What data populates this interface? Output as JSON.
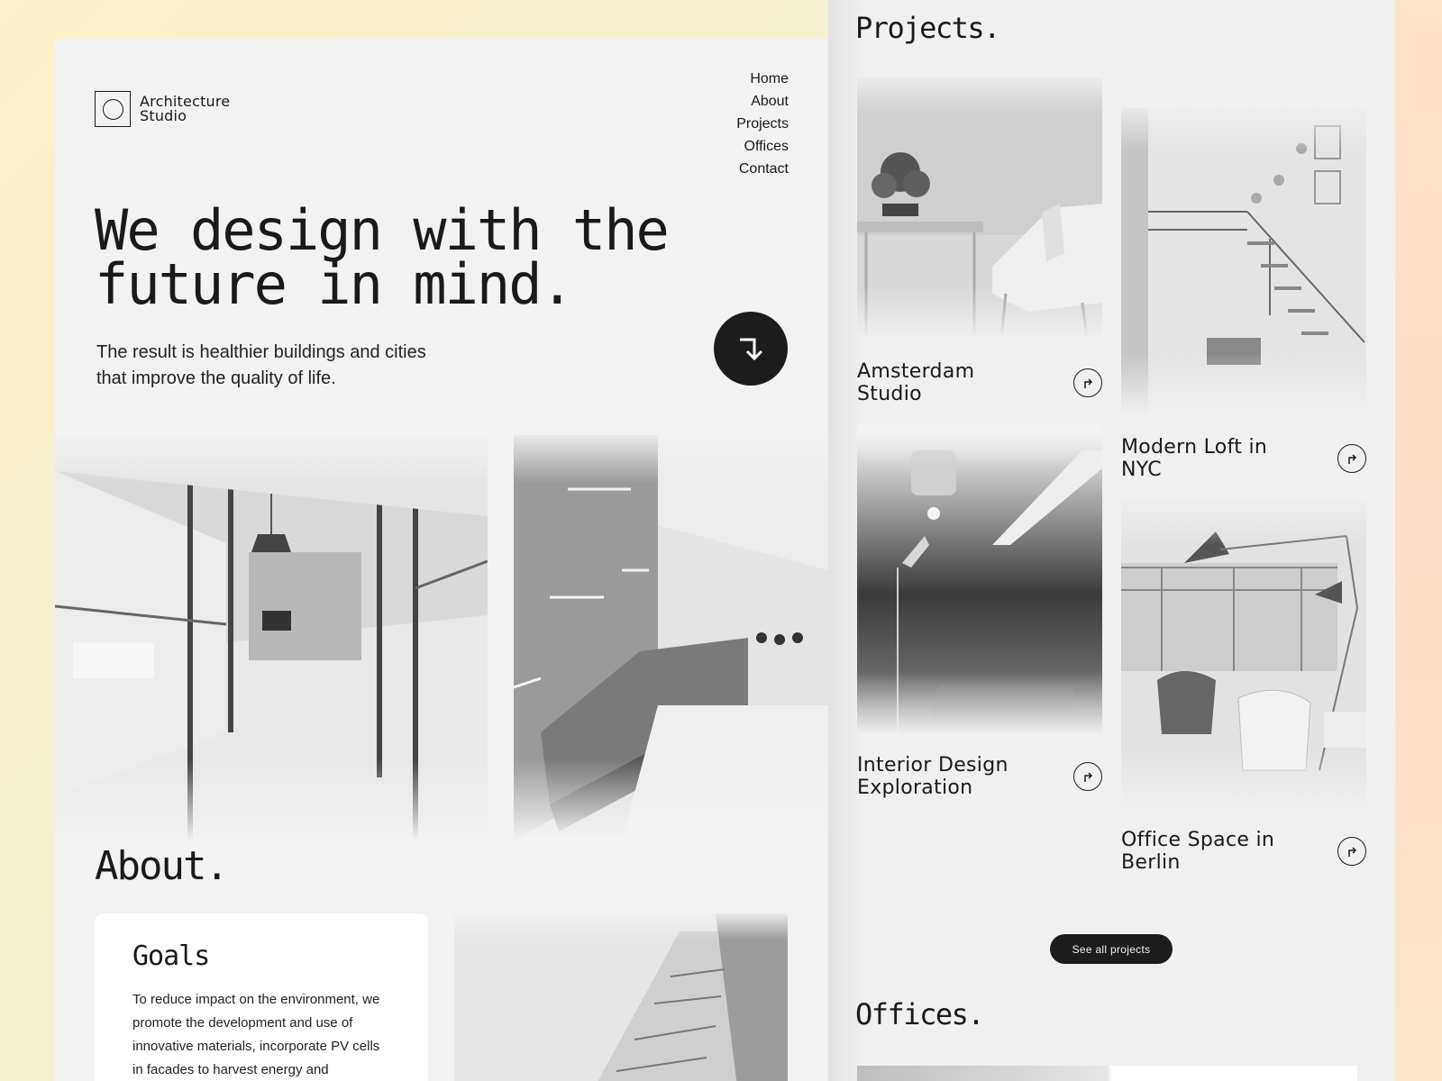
{
  "brand": {
    "line1": "Architecture",
    "line2": "Studio"
  },
  "nav": [
    "Home",
    "About",
    "Projects",
    "Offices",
    "Contact"
  ],
  "hero": {
    "title_line1": "We design with the",
    "title_line2": "future in mind.",
    "subtitle_line1": "The result is healthier buildings and cities",
    "subtitle_line2": "that improve the quality of life."
  },
  "about": {
    "title": "About.",
    "goals_title": "Goals",
    "goals_text": "To reduce impact on the environment, we promote the development and use of innovative materials, incorporate PV cells in facades to harvest energy and"
  },
  "projects": {
    "title": "Projects.",
    "items": [
      {
        "name_line1": "Amsterdam",
        "name_line2": "Studio"
      },
      {
        "name_line1": "Modern Loft in",
        "name_line2": "NYC"
      },
      {
        "name_line1": "Interior Design",
        "name_line2": "Exploration"
      },
      {
        "name_line1": "Office Space in",
        "name_line2": "Berlin"
      }
    ],
    "see_all": "See all projects"
  },
  "offices": {
    "title": "Offices."
  },
  "icons": {
    "hero_button": "arrow-down-right-icon",
    "project_button": "arrow-up-right-turn-icon",
    "logo": "logo-square-circle-icon"
  },
  "colors": {
    "background_panel": "#f2f2f2",
    "dark": "#1c1c1c",
    "text": "#1a1a1a"
  }
}
